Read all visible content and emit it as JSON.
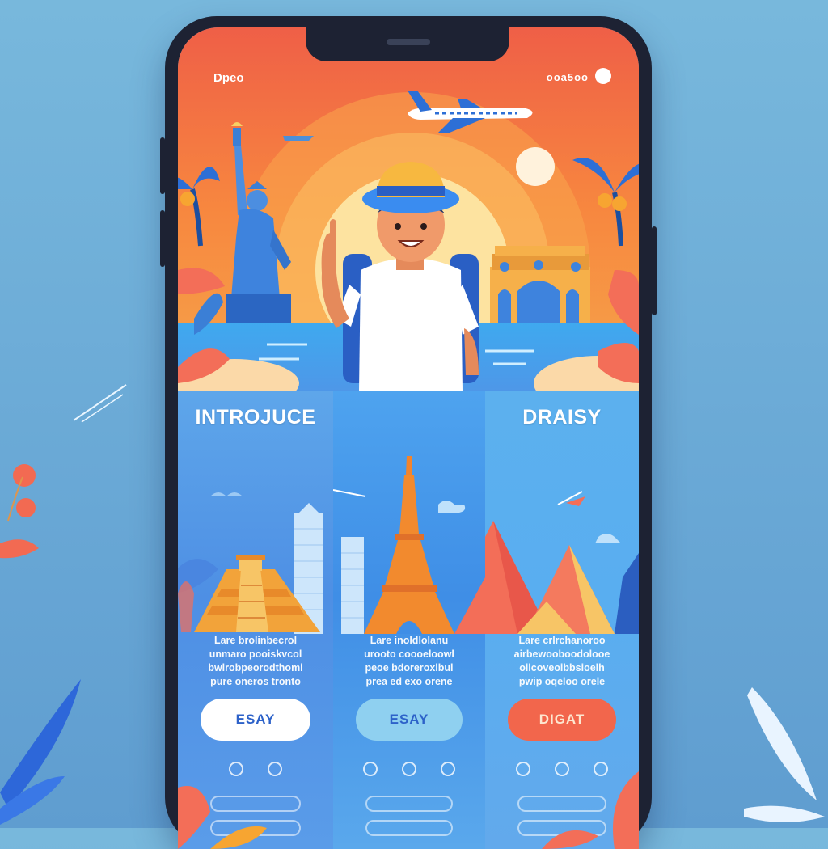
{
  "status_bar": {
    "left": "Dpeo",
    "right": "ooa5oo"
  },
  "columns": [
    {
      "title": "INTROJUCE",
      "description": [
        "Lare brolinbecrol",
        "unmaro pooiskvcol",
        "bwlrobpeorodthomi",
        "pure oneros tronto"
      ],
      "button_label": "ESAY"
    },
    {
      "title": "",
      "description": [
        "Lare inoldlolanu",
        "urooto coooeloowl",
        "peoe bdoreroxlbul",
        "prea ed exo orene"
      ],
      "button_label": "ESAY"
    },
    {
      "title": "DRAISY",
      "description": [
        "Lare crlrchanoroo",
        "airbewooboodolooe",
        "oilcoveoibbsioelh",
        "pwip oqeloo orele"
      ],
      "button_label": "DIGAT"
    }
  ],
  "colors": {
    "hero_top": "#f0664a",
    "hero_mid": "#f89a3e",
    "sky_blue": "#5ea3e2",
    "button_white": "#ffffff",
    "button_light_blue": "#8fd0f0",
    "button_coral": "#f2664c"
  }
}
